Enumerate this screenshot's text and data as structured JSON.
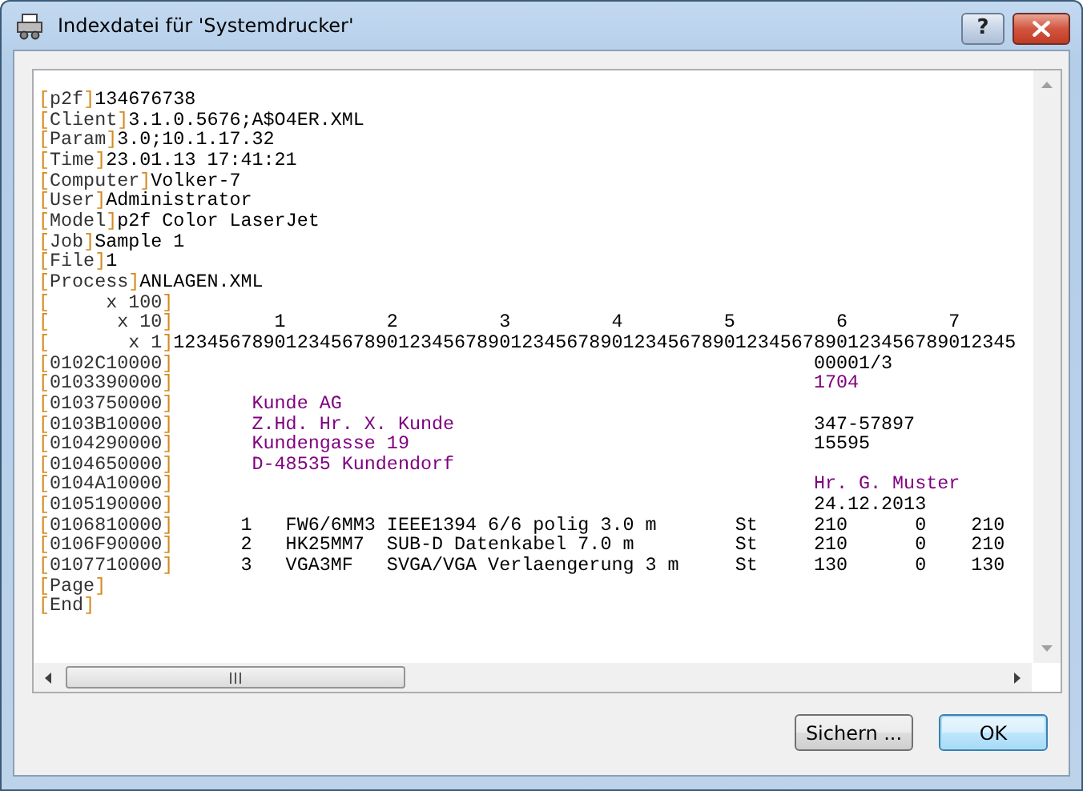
{
  "window": {
    "title": "Indexdatei für 'Systemdrucker'",
    "help_button": "?"
  },
  "lines": [
    {
      "tag": "[p2f]",
      "segments": [
        {
          "text": "134676738",
          "kind": "plain"
        }
      ]
    },
    {
      "tag": "[Client]",
      "segments": [
        {
          "text": "3.1.0.5676;A$O4ER.XML",
          "kind": "plain"
        }
      ]
    },
    {
      "tag": "[Param]",
      "segments": [
        {
          "text": "3.0;10.1.17.32",
          "kind": "plain"
        }
      ]
    },
    {
      "tag": "[Time]",
      "segments": [
        {
          "text": "23.01.13 17:41:21",
          "kind": "plain"
        }
      ]
    },
    {
      "tag": "[Computer]",
      "segments": [
        {
          "text": "Volker-7",
          "kind": "plain"
        }
      ]
    },
    {
      "tag": "[User]",
      "segments": [
        {
          "text": "Administrator",
          "kind": "plain"
        }
      ]
    },
    {
      "tag": "[Model]",
      "segments": [
        {
          "text": "p2f Color LaserJet",
          "kind": "plain"
        }
      ]
    },
    {
      "tag": "[Job]",
      "segments": [
        {
          "text": "Sample 1",
          "kind": "plain"
        }
      ]
    },
    {
      "tag": "[File]",
      "segments": [
        {
          "text": "1",
          "kind": "plain"
        }
      ]
    },
    {
      "tag": "[Process]",
      "segments": [
        {
          "text": "ANLAGEN.XML",
          "kind": "plain"
        }
      ]
    },
    {
      "tag": "[     x 100]"
    },
    {
      "tag": "[      x 10]",
      "segments": [
        {
          "text": "         1         2         3         4         5         6         7",
          "kind": "plain"
        }
      ]
    },
    {
      "tag": "[       x 1]",
      "segments": [
        {
          "text": "123456789012345678901234567890123456789012345678901234567890123456789012345",
          "kind": "plain"
        }
      ]
    },
    {
      "tag": "[0102C10000]",
      "segments": [
        {
          "text": "                                                         00001/3",
          "kind": "plain"
        }
      ]
    },
    {
      "tag": "[0103390000]",
      "segments": [
        {
          "text": "                                                         1704",
          "kind": "field"
        }
      ]
    },
    {
      "tag": "[0103750000]",
      "segments": [
        {
          "text": "       Kunde AG",
          "kind": "field"
        }
      ]
    },
    {
      "tag": "[0103B10000]",
      "segments": [
        {
          "text": "       Z.Hd. Hr. X. Kunde",
          "kind": "field"
        },
        {
          "text": "                                347-57897",
          "kind": "plain"
        }
      ]
    },
    {
      "tag": "[0104290000]",
      "segments": [
        {
          "text": "       Kundengasse 19",
          "kind": "field"
        },
        {
          "text": "                                    15595",
          "kind": "plain"
        }
      ]
    },
    {
      "tag": "[0104650000]",
      "segments": [
        {
          "text": "       D-48535 Kundendorf",
          "kind": "field"
        }
      ]
    },
    {
      "tag": "[0104A10000]",
      "segments": [
        {
          "text": "                                                         Hr. G. Muster",
          "kind": "field"
        }
      ]
    },
    {
      "tag": "[0105190000]",
      "segments": [
        {
          "text": "                                                         24.12.2013",
          "kind": "plain"
        }
      ]
    },
    {
      "tag": "[0106810000]",
      "segments": [
        {
          "text": "      1   FW6/6MM3 IEEE1394 6/6 polig 3.0 m       St     210      0    210",
          "kind": "plain"
        }
      ]
    },
    {
      "tag": "[0106F90000]",
      "segments": [
        {
          "text": "      2   HK25MM7  SUB-D Datenkabel 7.0 m         St     210      0    210",
          "kind": "plain"
        }
      ]
    },
    {
      "tag": "[0107710000]",
      "segments": [
        {
          "text": "      3   VGA3MF   SVGA/VGA Verlaengerung 3 m     St     130      0    130",
          "kind": "plain"
        }
      ]
    },
    {
      "tag": "[Page]"
    },
    {
      "tag": "[End]"
    }
  ],
  "buttons": [
    {
      "label": "Sichern ...",
      "default": false
    },
    {
      "label": "OK",
      "default": true
    }
  ]
}
